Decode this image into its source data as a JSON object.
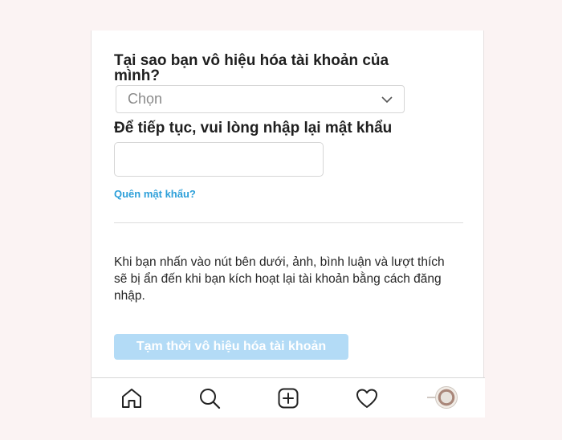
{
  "form": {
    "question": "Tại sao bạn vô hiệu hóa tài khoản của mình?",
    "reason_select": {
      "value": "Chọn"
    },
    "password_label": "Để tiếp tục, vui lòng nhập lại mật khẩu",
    "password_input": {
      "value": "",
      "placeholder": ""
    },
    "forgot_link": "Quên mật khẩu?",
    "notice": "Khi bạn nhấn vào nút bên dưới, ảnh, bình luận và lượt thích sẽ bị ẩn đến khi bạn kích hoạt lại tài khoản bằng cách đăng nhập.",
    "deactivate_button": "Tạm thời vô hiệu hóa tài khoản"
  },
  "tabbar": {
    "items": [
      {
        "icon": "home-icon"
      },
      {
        "icon": "search-icon"
      },
      {
        "icon": "add-post-icon"
      },
      {
        "icon": "heart-icon"
      },
      {
        "icon": "profile-avatar"
      }
    ]
  },
  "colors": {
    "link": "#2c9fd9",
    "button_disabled": "#b3dbf6",
    "text": "#1f1f1f"
  }
}
